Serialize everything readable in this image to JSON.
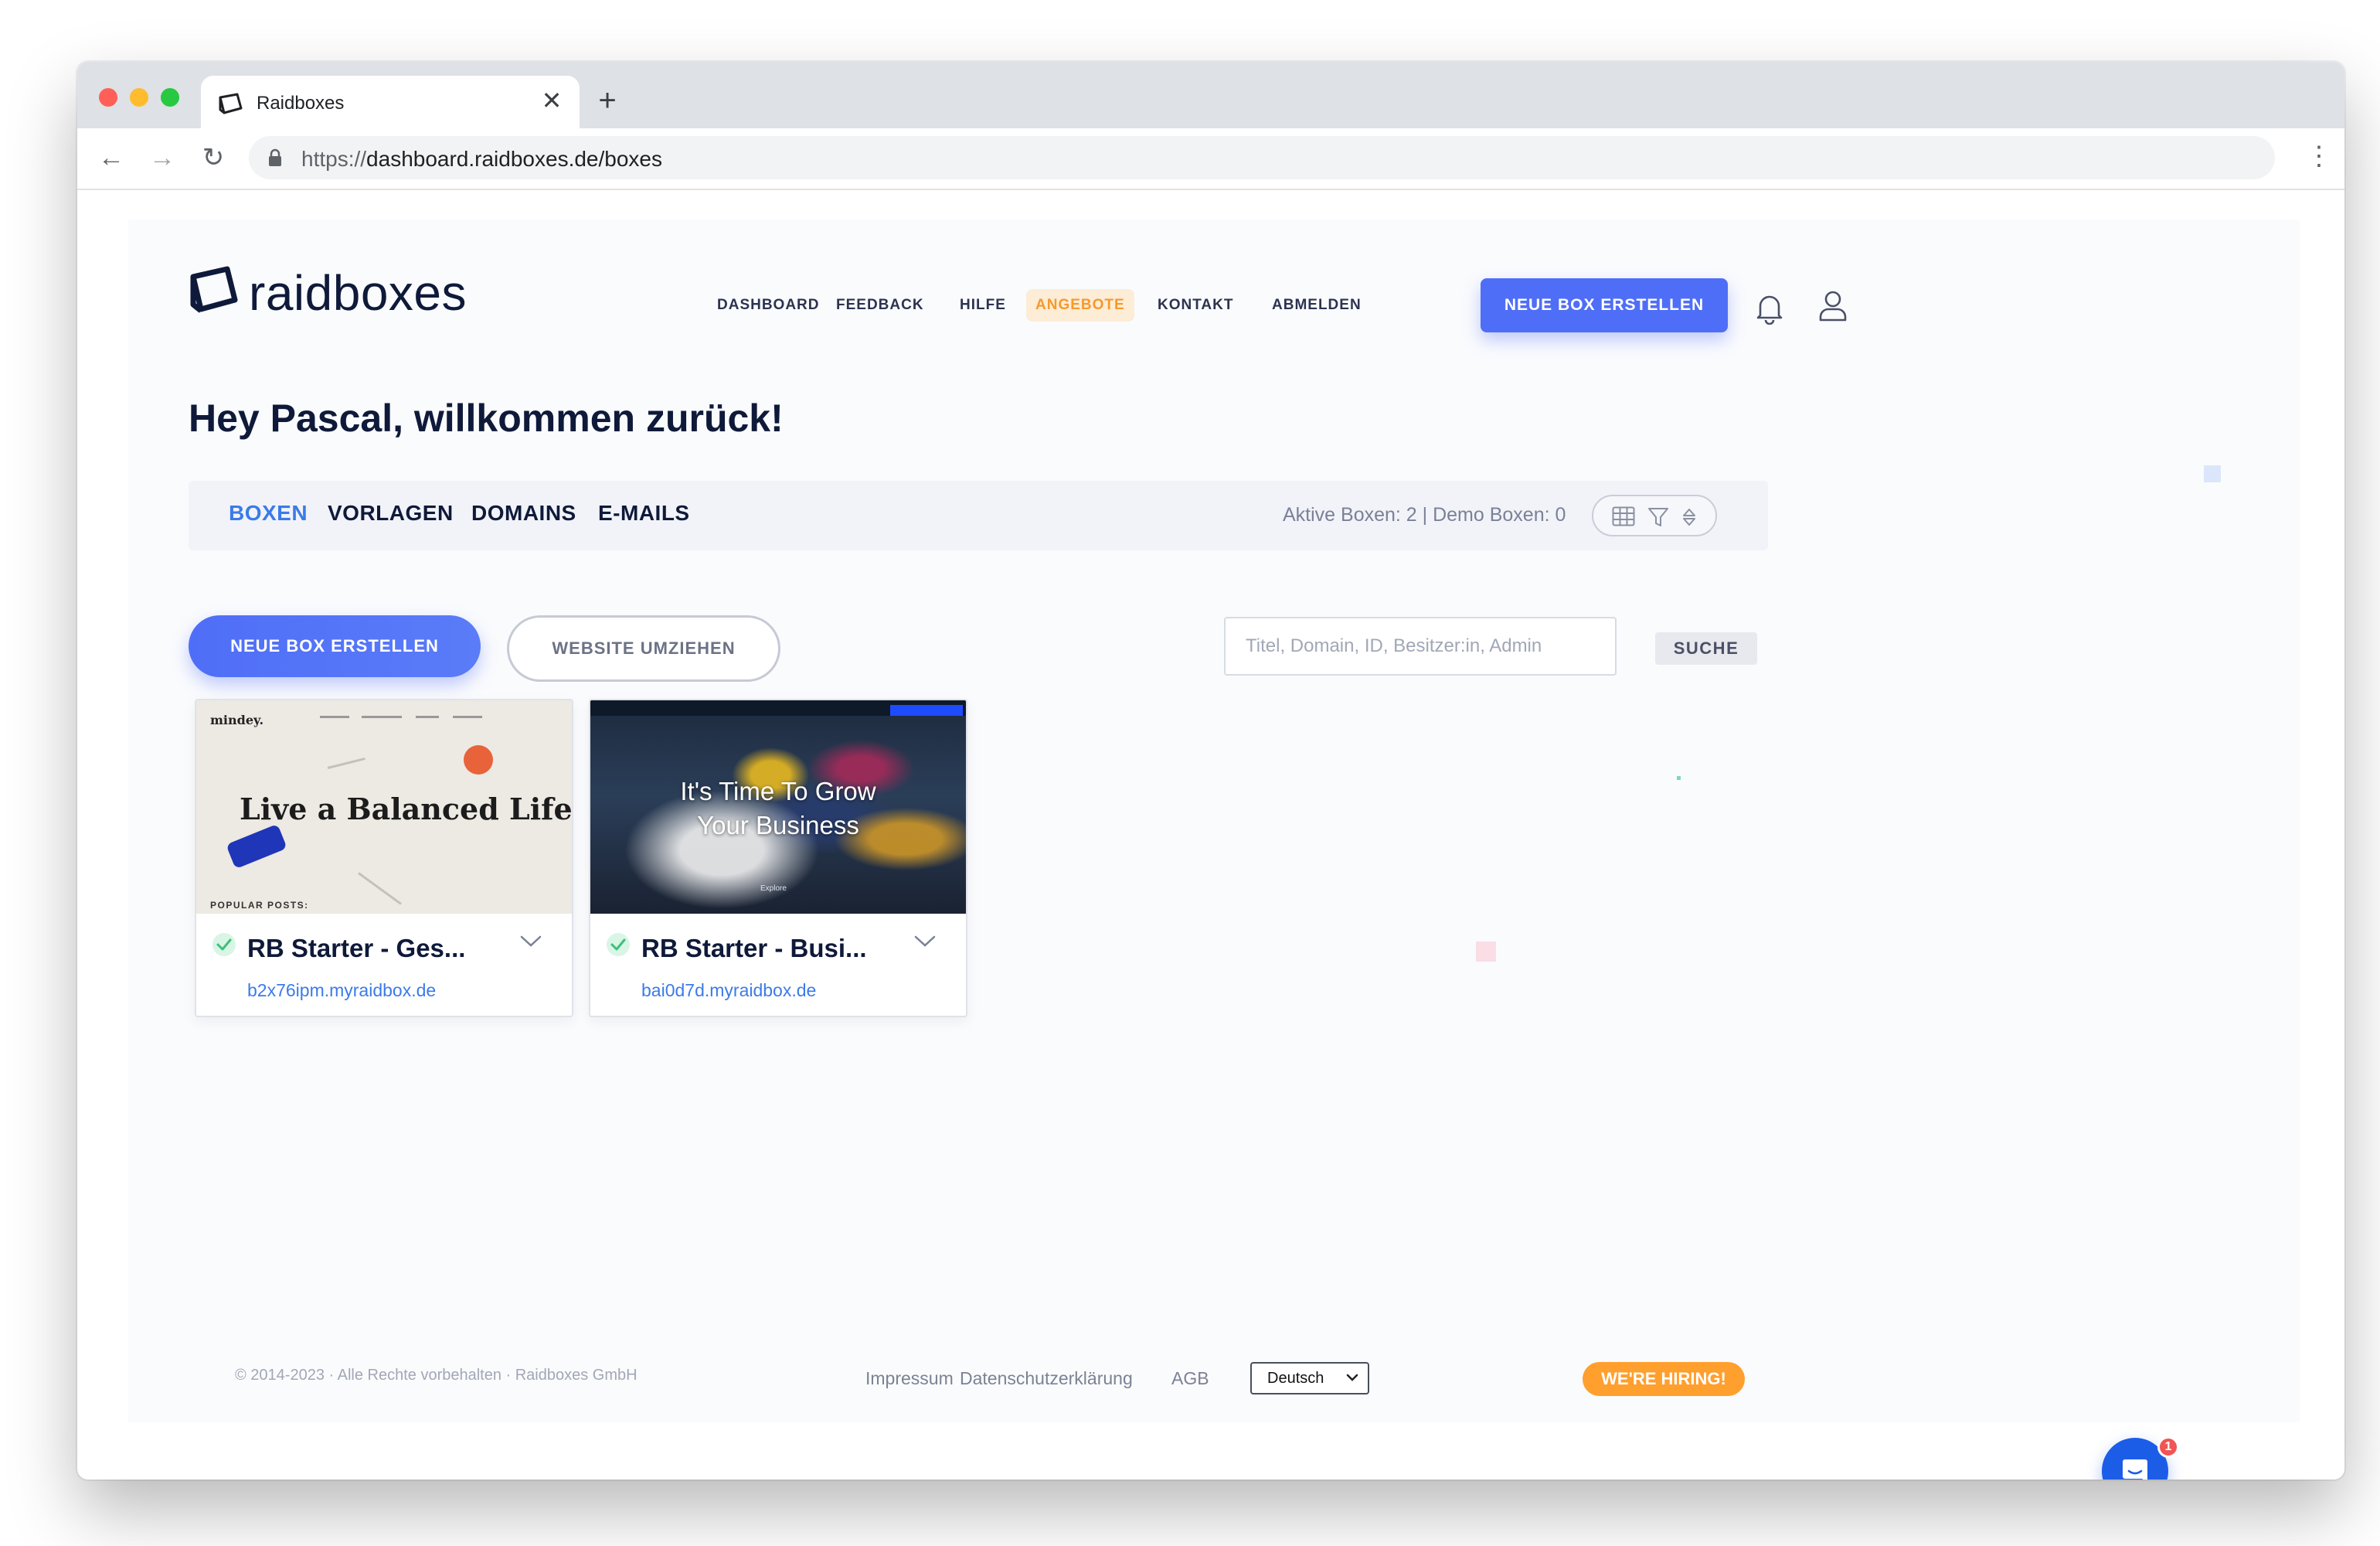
{
  "browser": {
    "tab_title": "Raidboxes",
    "tab_close": "✕",
    "new_tab": "+",
    "url_scheme": "https://",
    "url_rest": "dashboard.raidboxes.de/boxes",
    "back": "←",
    "forward": "→",
    "reload": "↻",
    "menu": "⋮"
  },
  "header": {
    "logo_text": "raidboxes",
    "nav": [
      "DASHBOARD",
      "FEEDBACK",
      "HILFE",
      "ANGEBOTE",
      "KONTAKT",
      "ABMELDEN"
    ],
    "cta": "NEUE BOX ERSTELLEN",
    "icons": [
      "bell-icon",
      "user-icon"
    ]
  },
  "welcome": "Hey Pascal, willkommen zurück!",
  "tabs": [
    "BOXEN",
    "VORLAGEN",
    "DOMAINS",
    "E-MAILS"
  ],
  "active_tab": "BOXEN",
  "stats": "Aktive Boxen: 2 | Demo Boxen: 0",
  "actions": {
    "new_box": "NEUE BOX ERSTELLEN",
    "move_site": "WEBSITE UMZIEHEN",
    "search_placeholder": "Titel, Domain, ID, Besitzer:in, Admin",
    "search_button": "SUCHE"
  },
  "boxes": [
    {
      "title": "RB Starter - Ges...",
      "domain": "b2x76ipm.myraidbox.de",
      "status": "active",
      "thumb": {
        "brand": "mindey.",
        "headline": "Live a Balanced Life",
        "posts_label": "POPULAR POSTS:"
      }
    },
    {
      "title": "RB Starter - Busi...",
      "domain": "bai0d7d.myraidbox.de",
      "status": "active",
      "thumb": {
        "headline_line1": "It's Time To Grow",
        "headline_line2": "Your Business",
        "explore": "Explore"
      }
    }
  ],
  "footer": {
    "copyright": "© 2014-2023 · Alle Rechte vorbehalten · Raidboxes GmbH",
    "links": [
      "Impressum",
      "Datenschutzerklärung",
      "AGB"
    ],
    "language": "Deutsch",
    "hiring": "WE'RE HIRING!"
  },
  "chat": {
    "badge": "1"
  },
  "colors": {
    "primary": "#4f6ef7",
    "link": "#3b7be8",
    "offer": "#f49a2c",
    "hiring": "#ff9f2d",
    "success": "#3ec07a",
    "text_dark": "#0f1a3a"
  }
}
